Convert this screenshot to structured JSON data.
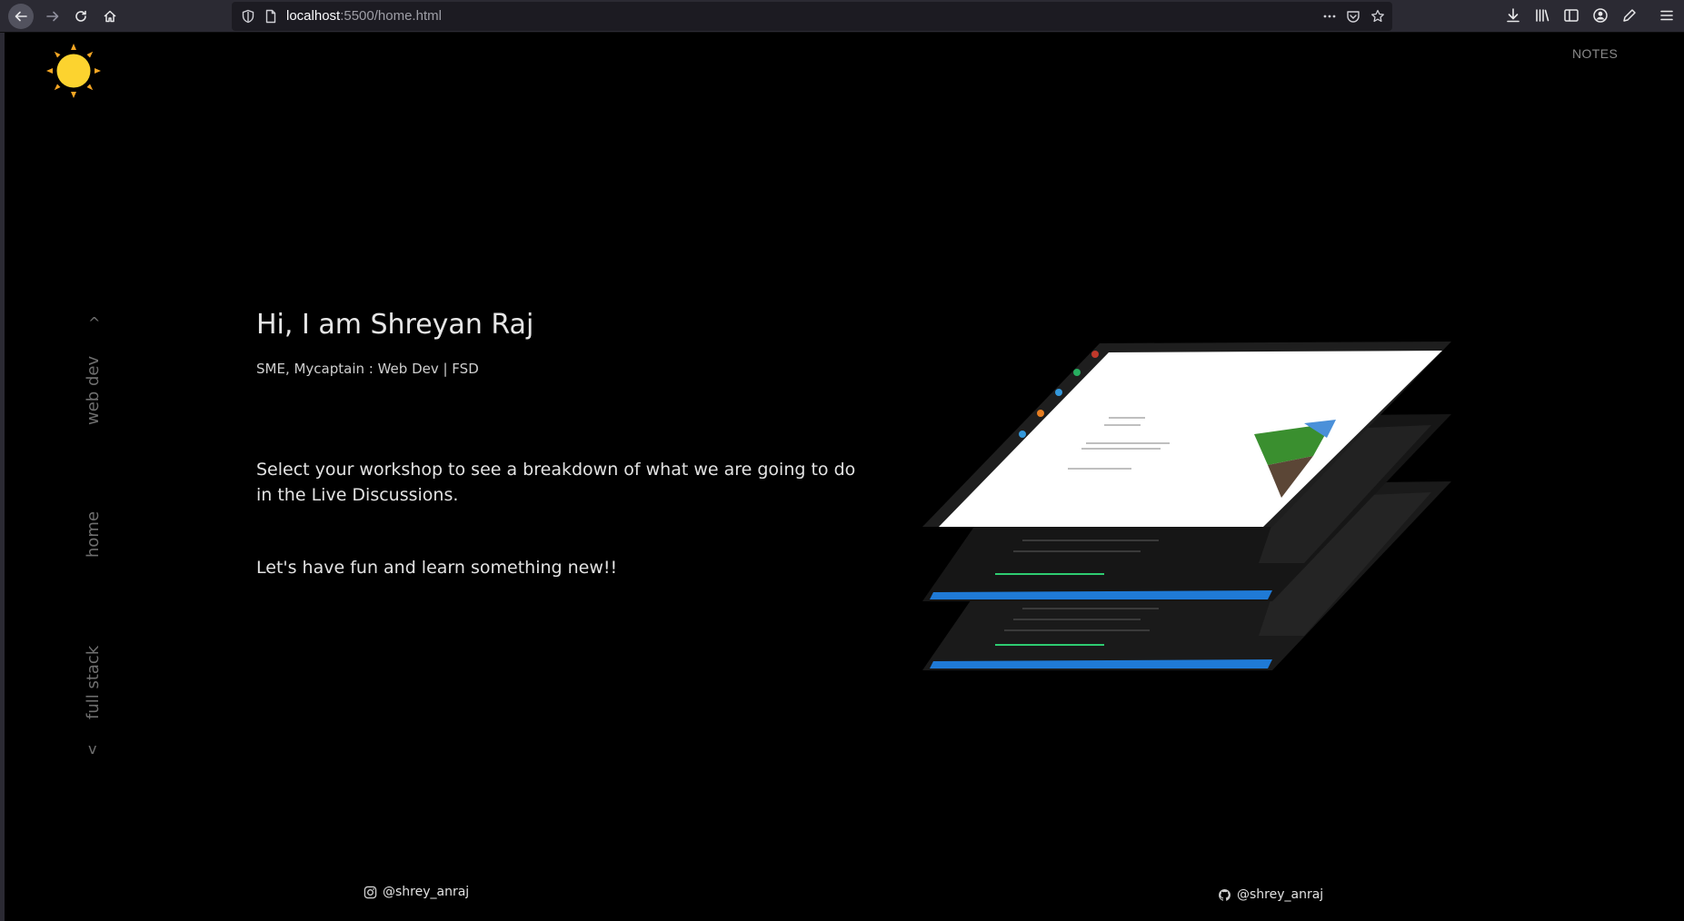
{
  "browser": {
    "url_host": "localhost",
    "url_path": ":5500/home.html"
  },
  "nav": {
    "notes_label": "NOTES",
    "up_arrow": "^",
    "down_arrow": "v",
    "items": [
      {
        "label": "web dev"
      },
      {
        "label": "home"
      },
      {
        "label": "full stack"
      }
    ]
  },
  "hero": {
    "title": "Hi, I am  Shreyan Raj",
    "subtitle": "SME, Mycaptain : Web Dev | FSD",
    "paragraph1": "Select your workshop to see a breakdown of what we are going to do in the Live Discussions.",
    "paragraph2": "Let's have fun and learn something new!!"
  },
  "footer": {
    "instagram": "@shrey_anraj",
    "github": "@shrey_anraj"
  },
  "colors": {
    "background": "#000000",
    "sun": "#fcd32f",
    "sun_rays": "#f5a623",
    "accent_blue": "#1f7ad6"
  }
}
